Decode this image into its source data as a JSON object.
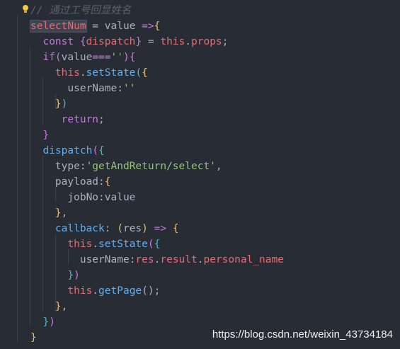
{
  "code": {
    "lines": [
      [
        {
          "t": "// 通过工号回显姓名",
          "c": "c-comment"
        }
      ],
      [
        {
          "t": "selectNum",
          "c": "c-var sel"
        },
        {
          "t": " = ",
          "c": "c-plain"
        },
        {
          "t": "value",
          "c": "c-plain"
        },
        {
          "t": " =>",
          "c": "c-kw"
        },
        {
          "t": "{",
          "c": "c-y"
        }
      ],
      [
        {
          "t": "  const ",
          "c": "c-kw"
        },
        {
          "t": "{",
          "c": "c-p"
        },
        {
          "t": "dispatch",
          "c": "c-var"
        },
        {
          "t": "}",
          "c": "c-p"
        },
        {
          "t": " = ",
          "c": "c-plain"
        },
        {
          "t": "this",
          "c": "c-var"
        },
        {
          "t": ".",
          "c": "c-plain"
        },
        {
          "t": "props",
          "c": "c-var"
        },
        {
          "t": ";",
          "c": "c-plain"
        }
      ],
      [
        {
          "t": "  if",
          "c": "c-kw"
        },
        {
          "t": "(",
          "c": "c-p"
        },
        {
          "t": "value",
          "c": "c-plain"
        },
        {
          "t": "===",
          "c": "c-kw"
        },
        {
          "t": "''",
          "c": "c-str"
        },
        {
          "t": ")",
          "c": "c-p"
        },
        {
          "t": "{",
          "c": "c-p"
        }
      ],
      [
        {
          "t": "    this",
          "c": "c-var"
        },
        {
          "t": ".",
          "c": "c-plain"
        },
        {
          "t": "setState",
          "c": "c-fn"
        },
        {
          "t": "(",
          "c": "c-b"
        },
        {
          "t": "{",
          "c": "c-y"
        }
      ],
      [
        {
          "t": "      userName",
          "c": "c-plain"
        },
        {
          "t": ":",
          "c": "c-plain"
        },
        {
          "t": "''",
          "c": "c-str"
        }
      ],
      [
        {
          "t": "    }",
          "c": "c-y"
        },
        {
          "t": ")",
          "c": "c-b"
        }
      ],
      [
        {
          "t": "     return",
          "c": "c-kw"
        },
        {
          "t": ";",
          "c": "c-plain"
        }
      ],
      [
        {
          "t": "  }",
          "c": "c-p"
        }
      ],
      [
        {
          "t": "  dispatch",
          "c": "c-fn"
        },
        {
          "t": "(",
          "c": "c-p"
        },
        {
          "t": "{",
          "c": "c-b"
        }
      ],
      [
        {
          "t": "    type",
          "c": "c-plain"
        },
        {
          "t": ":",
          "c": "c-plain"
        },
        {
          "t": "'getAndReturn/select'",
          "c": "c-str"
        },
        {
          "t": ",",
          "c": "c-plain"
        }
      ],
      [
        {
          "t": "    payload",
          "c": "c-plain"
        },
        {
          "t": ":",
          "c": "c-plain"
        },
        {
          "t": "{",
          "c": "c-y"
        }
      ],
      [
        {
          "t": "      jobNo",
          "c": "c-plain"
        },
        {
          "t": ":",
          "c": "c-plain"
        },
        {
          "t": "value",
          "c": "c-plain"
        }
      ],
      [
        {
          "t": "    }",
          "c": "c-y"
        },
        {
          "t": ",",
          "c": "c-plain"
        }
      ],
      [
        {
          "t": "    callback",
          "c": "c-fn"
        },
        {
          "t": ": ",
          "c": "c-plain"
        },
        {
          "t": "(",
          "c": "c-y"
        },
        {
          "t": "res",
          "c": "c-plain"
        },
        {
          "t": ")",
          "c": "c-y"
        },
        {
          "t": " => ",
          "c": "c-kw"
        },
        {
          "t": "{",
          "c": "c-y"
        }
      ],
      [
        {
          "t": "      this",
          "c": "c-var"
        },
        {
          "t": ".",
          "c": "c-plain"
        },
        {
          "t": "setState",
          "c": "c-fn"
        },
        {
          "t": "(",
          "c": "c-p"
        },
        {
          "t": "{",
          "c": "c-b"
        }
      ],
      [
        {
          "t": "        userName",
          "c": "c-plain"
        },
        {
          "t": ":",
          "c": "c-plain"
        },
        {
          "t": "res",
          "c": "c-var"
        },
        {
          "t": ".",
          "c": "c-plain"
        },
        {
          "t": "result",
          "c": "c-var"
        },
        {
          "t": ".",
          "c": "c-plain"
        },
        {
          "t": "personal_name",
          "c": "c-var"
        }
      ],
      [
        {
          "t": "      }",
          "c": "c-b"
        },
        {
          "t": ")",
          "c": "c-p"
        }
      ],
      [
        {
          "t": "      this",
          "c": "c-var"
        },
        {
          "t": ".",
          "c": "c-plain"
        },
        {
          "t": "getPage",
          "c": "c-fn"
        },
        {
          "t": "();",
          "c": "c-plain"
        }
      ],
      [
        {
          "t": "    }",
          "c": "c-y"
        },
        {
          "t": ",",
          "c": "c-plain"
        }
      ],
      [
        {
          "t": "  }",
          "c": "c-b"
        },
        {
          "t": ")",
          "c": "c-p"
        }
      ],
      [
        {
          "t": "}",
          "c": "c-y"
        }
      ]
    ]
  },
  "watermark": "https://blog.csdn.net/weixin_43734184"
}
